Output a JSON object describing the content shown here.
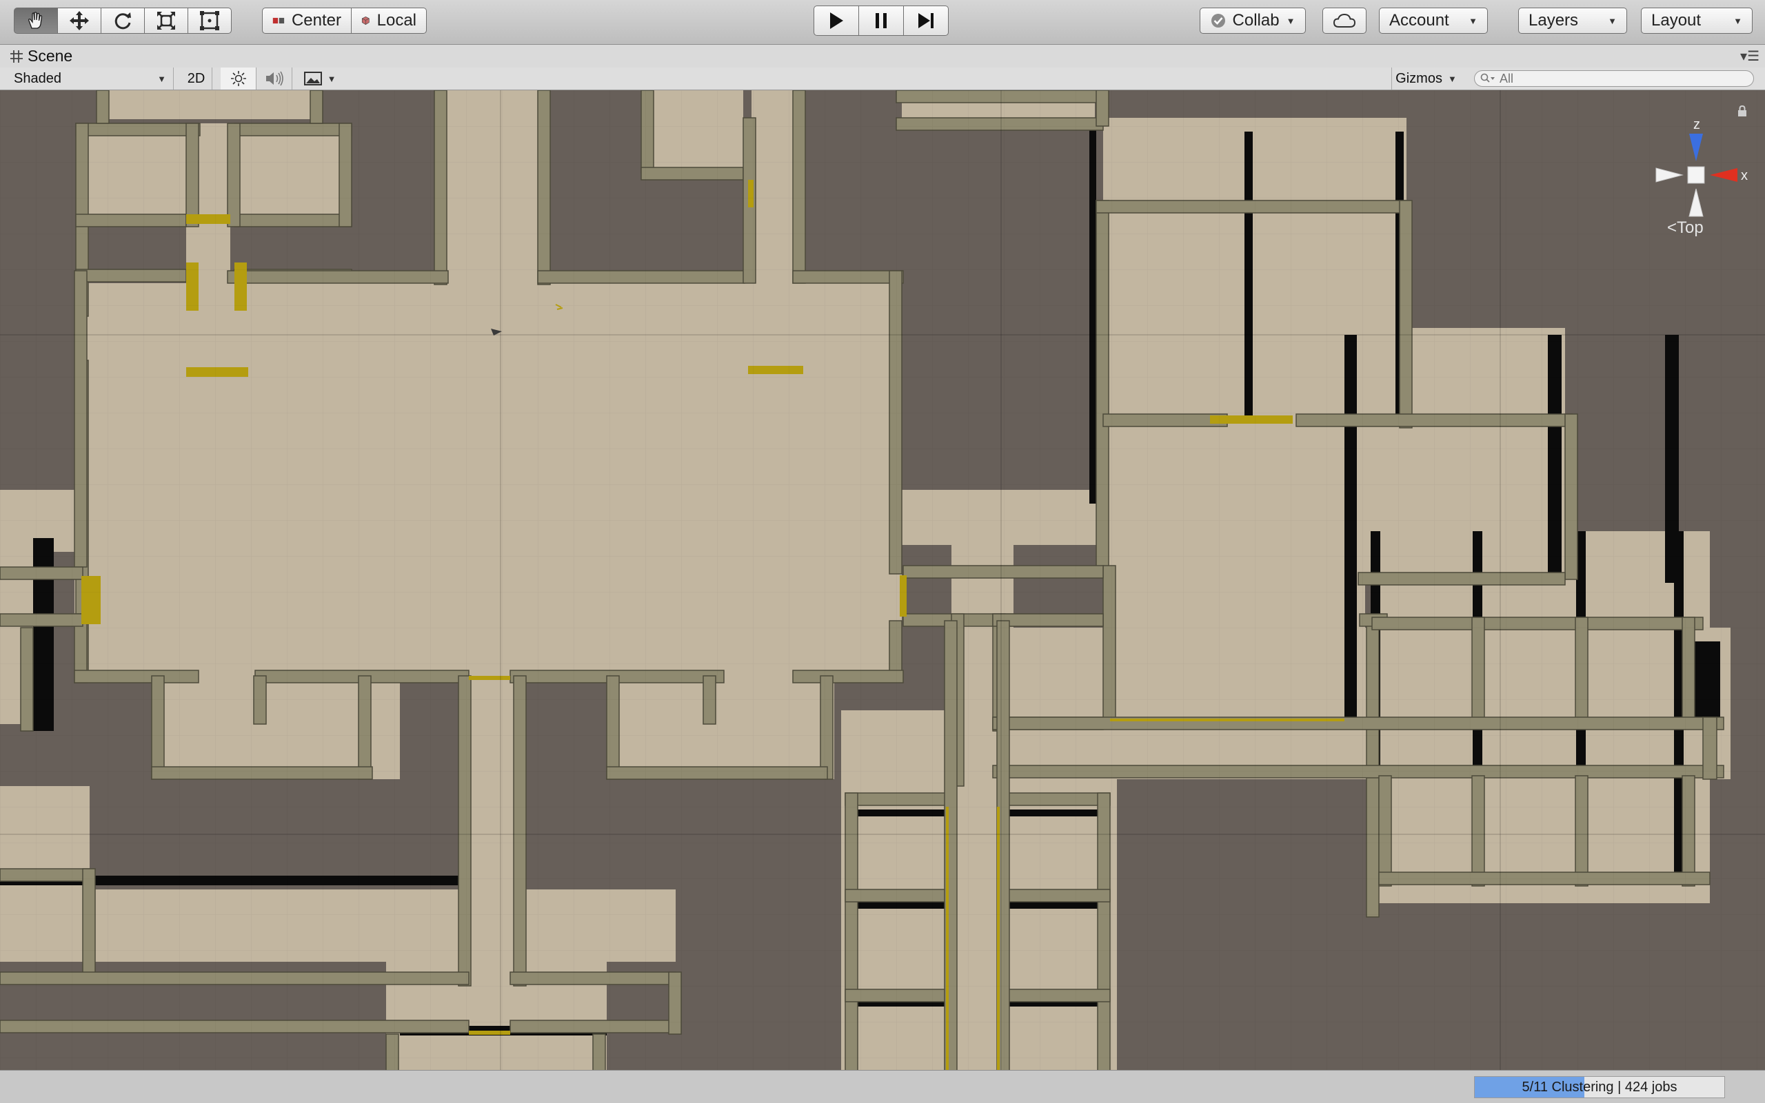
{
  "toolbar": {
    "tools": [
      {
        "icon": "hand-icon",
        "active": true
      },
      {
        "icon": "move-icon",
        "active": false
      },
      {
        "icon": "rotate-icon",
        "active": false
      },
      {
        "icon": "scale-icon",
        "active": false
      },
      {
        "icon": "rect-transform-icon",
        "active": false
      }
    ],
    "pivot_label": "Center",
    "space_label": "Local",
    "playback": [
      "play-icon",
      "pause-icon",
      "step-icon"
    ],
    "collab_label": "Collab",
    "cloud_icon": "cloud-icon",
    "account_label": "Account",
    "layers_label": "Layers",
    "layout_label": "Layout"
  },
  "scene_tab": {
    "label": "Scene",
    "icon": "grid-hash-icon"
  },
  "scene_toolbar": {
    "draw_mode": "Shaded",
    "mode_2d": "2D",
    "lighting_icon": "sun-icon",
    "audio_icon": "speaker-icon",
    "effects_icon": "image-icon",
    "gizmos_label": "Gizmos",
    "search_placeholder": "All"
  },
  "gizmo": {
    "z_label": "z",
    "x_label": "x",
    "view_label": "Top"
  },
  "colors": {
    "background": "#675f59",
    "floor": "#c2b6a0",
    "wall": "#8f8a70",
    "door": "#b49d10",
    "shadow": "#0b0b0b",
    "progress": "#6fa1e6"
  },
  "status": {
    "progress_fraction": 0.44,
    "progress_text": "5/11 Clustering | 424 jobs"
  }
}
